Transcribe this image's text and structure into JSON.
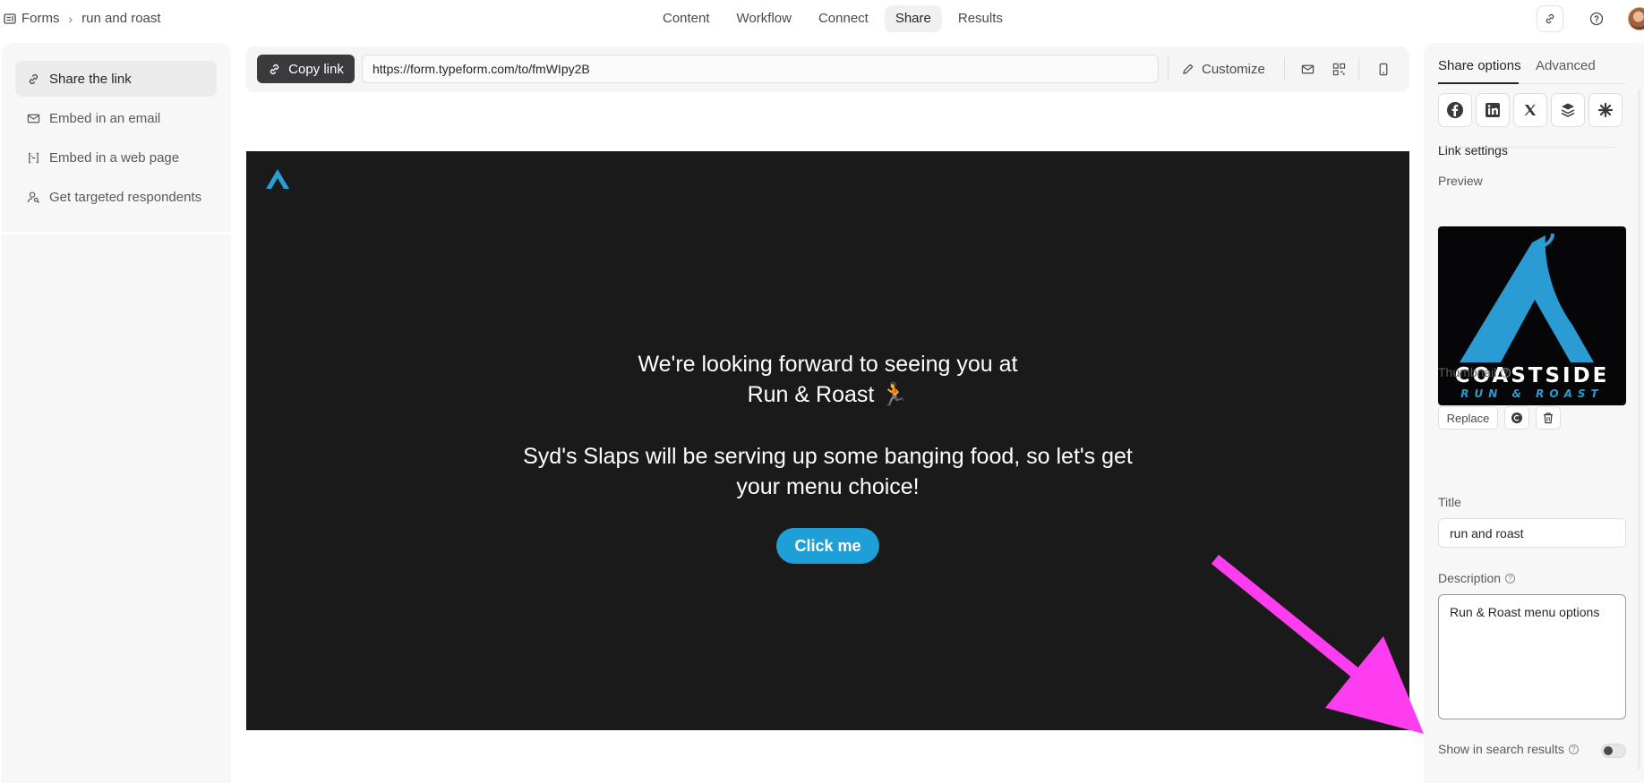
{
  "breadcrumb": {
    "root": "Forms",
    "current": "run and roast"
  },
  "nav_tabs": [
    {
      "label": "Content"
    },
    {
      "label": "Workflow"
    },
    {
      "label": "Connect"
    },
    {
      "label": "Share",
      "active": true
    },
    {
      "label": "Results"
    }
  ],
  "sidebar": {
    "items": [
      {
        "label": "Share the link",
        "icon": "link-icon",
        "active": true
      },
      {
        "label": "Embed in an email",
        "icon": "mail-icon"
      },
      {
        "label": "Embed in a web page",
        "icon": "code-brackets-icon"
      },
      {
        "label": "Get targeted respondents",
        "icon": "user-search-icon"
      }
    ]
  },
  "sharebar": {
    "copy_label": "Copy link",
    "url": "https://form.typeform.com/to/fmWIpy2B",
    "customize_label": "Customize"
  },
  "preview": {
    "line1": "We're looking forward to seeing you at",
    "line2": "Run & Roast 🏃",
    "line3": "Syd's Slaps will be serving up some banging food, so let's get",
    "line4": "your menu choice!",
    "button_label": "Click me",
    "background": "#1a1a1a",
    "button_color": "#1f9fd7"
  },
  "right_panel": {
    "tabs": [
      {
        "label": "Share options",
        "active": true
      },
      {
        "label": "Advanced"
      }
    ],
    "social_icons": [
      "facebook-icon",
      "linkedin-icon",
      "x-icon",
      "layers-icon",
      "sparkle-icon"
    ],
    "link_settings_heading": "Link settings",
    "preview_label": "Preview",
    "thumbnail_logo_text_top": "COASTSIDE",
    "thumbnail_logo_text_bottom": "RUN & ROAST",
    "thumbnail_label": "Thumbnail",
    "replace_label": "Replace",
    "title_label": "Title",
    "title_value": "run and roast",
    "description_label": "Description",
    "description_value": "Run & Roast menu options",
    "search_results_label": "Show in search results",
    "search_results_enabled": false
  },
  "colors": {
    "accent_blue": "#1f9fd7",
    "copy_button": "#3b3a3c",
    "annotation_arrow": "#ff3df0"
  }
}
